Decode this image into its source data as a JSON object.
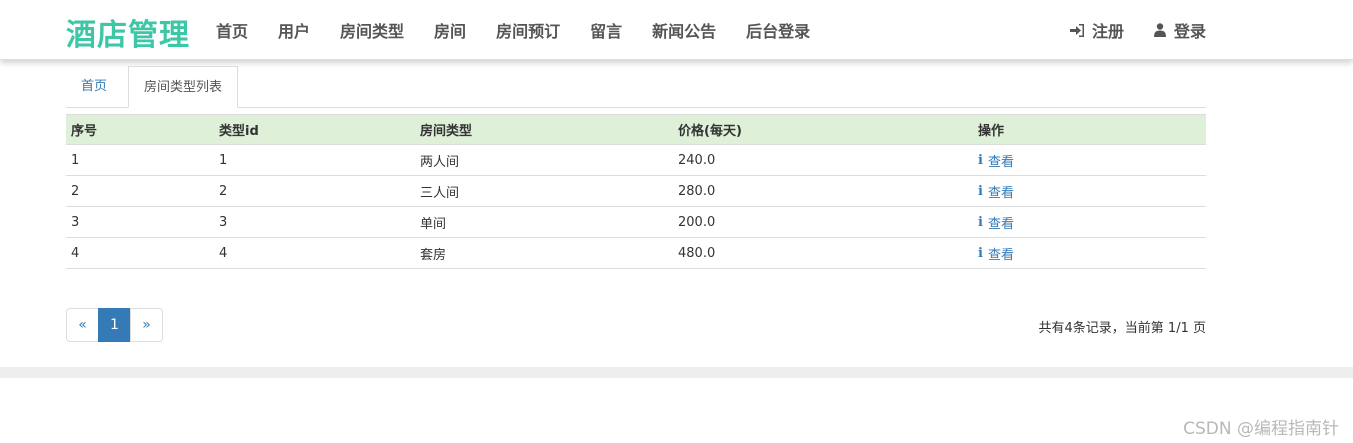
{
  "brand": "酒店管理",
  "nav": {
    "items": [
      {
        "label": "首页"
      },
      {
        "label": "用户"
      },
      {
        "label": "房间类型"
      },
      {
        "label": "房间"
      },
      {
        "label": "房间预订"
      },
      {
        "label": "留言"
      },
      {
        "label": "新闻公告"
      },
      {
        "label": "后台登录"
      }
    ],
    "register": "注册",
    "login": "登录"
  },
  "tabs": {
    "home": "首页",
    "active": "房间类型列表"
  },
  "table": {
    "headers": [
      "序号",
      "类型id",
      "房间类型",
      "价格(每天)",
      "操作"
    ],
    "rows": [
      {
        "no": "1",
        "type_id": "1",
        "type": "两人间",
        "price": "240.0",
        "action": "查看"
      },
      {
        "no": "2",
        "type_id": "2",
        "type": "三人间",
        "price": "280.0",
        "action": "查看"
      },
      {
        "no": "3",
        "type_id": "3",
        "type": "单间",
        "price": "200.0",
        "action": "查看"
      },
      {
        "no": "4",
        "type_id": "4",
        "type": "套房",
        "price": "480.0",
        "action": "查看"
      }
    ]
  },
  "pagination": {
    "prev": "«",
    "current": "1",
    "next": "»"
  },
  "record_info": "共有4条记录，当前第 1/1 页",
  "watermark": "CSDN @编程指南针",
  "colors": {
    "brand": "#3cc7a6",
    "link": "#337ab7",
    "header_bg": "#dff0d8"
  }
}
